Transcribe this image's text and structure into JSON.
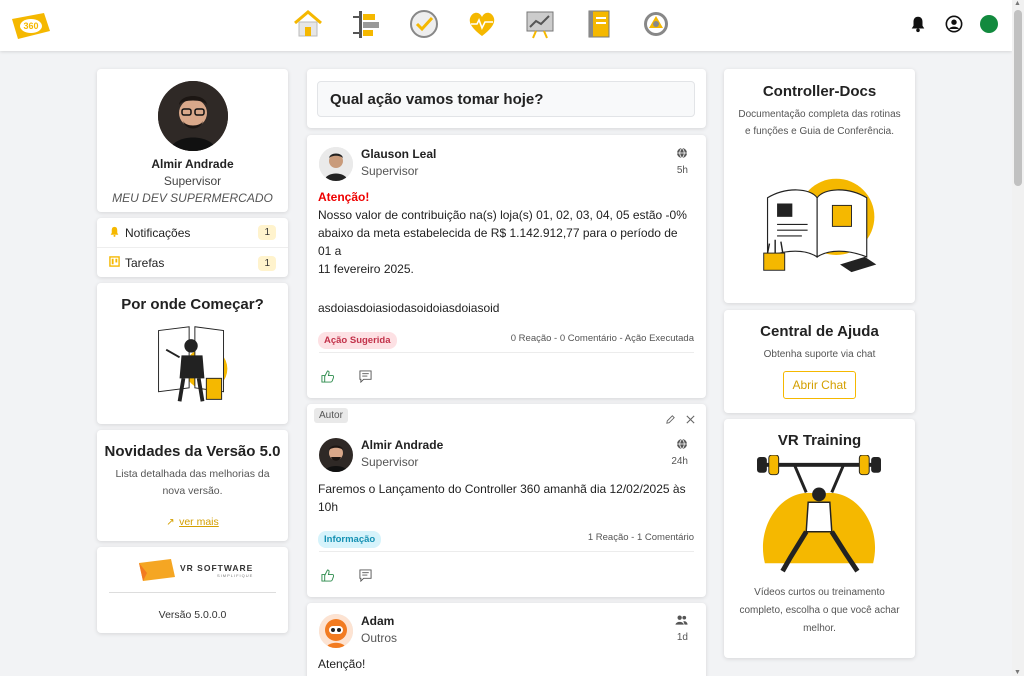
{
  "topbar": {
    "logo_text": "360",
    "nav": [
      "home-icon",
      "timeline-icon",
      "check-icon",
      "heart-pulse-icon",
      "chart-board-icon",
      "notebook-icon",
      "gear-icon"
    ],
    "accent": "#f5b800",
    "status_color": "#128a3e"
  },
  "profile": {
    "name": "Almir Andrade",
    "role": "Supervisor",
    "company": "MEU DEV SUPERMERCADO"
  },
  "menu": [
    {
      "label": "Notificações",
      "icon": "bell-icon",
      "count": "1"
    },
    {
      "label": "Tarefas",
      "icon": "tasks-icon",
      "count": "1"
    }
  ],
  "start_card": {
    "title": "Por onde Começar?"
  },
  "news_card": {
    "title": "Novidades da Versão 5.0",
    "desc_line1": "Lista detalhada das melhorias da",
    "desc_line2": "nova versão.",
    "link": "ver mais"
  },
  "vr_card": {
    "brand": "VR SOFTWARE",
    "tagline": "SIMPLIFIQUE",
    "version": "Versão 5.0.0.0"
  },
  "composer": {
    "prompt": "Qual ação vamos tomar hoje?"
  },
  "posts": [
    {
      "name": "Glauson Leal",
      "role": "Supervisor",
      "time": "5h",
      "visibility_icon": "globe-icon",
      "attention": "Atenção!",
      "body_lines": [
        "Nosso valor de contribuição na(s) loja(s) 01, 02, 03, 04, 05 estão -0%",
        "abaixo da meta estabelecida de R$ 1.142.912,77 para o período de 01 a",
        "11 fevereiro 2025."
      ],
      "extra": "asdoiasdoiasiodasoidoiasdoiasoid",
      "tag": "Ação Sugerida",
      "stats": "0 Reação - 0 Comentário - Ação Executada"
    },
    {
      "author_badge": "Autor",
      "name": "Almir Andrade",
      "role": "Supervisor",
      "time": "24h",
      "visibility_icon": "globe-icon",
      "body_lines": [
        "Faremos o Lançamento do Controller 360 amanhã dia 12/02/2025 às",
        "10h"
      ],
      "tag": "Informação",
      "stats": "1 Reação - 1 Comentário"
    },
    {
      "name": "Adam",
      "role": "Outros",
      "time": "1d",
      "visibility_icon": "group-icon",
      "attention": "Atenção!"
    }
  ],
  "docs_card": {
    "title": "Controller-Docs",
    "desc_line1": "Documentação completa das rotinas",
    "desc_line2": "e funções e Guia de Conferência."
  },
  "help_card": {
    "title": "Central de Ajuda",
    "desc": "Obtenha suporte via chat",
    "button": "Abrir Chat"
  },
  "training_card": {
    "title": "VR Training",
    "desc_line1": "Vídeos curtos ou treinamento",
    "desc_line2": "completo, escolha o que você achar",
    "desc_line3": "melhor."
  }
}
